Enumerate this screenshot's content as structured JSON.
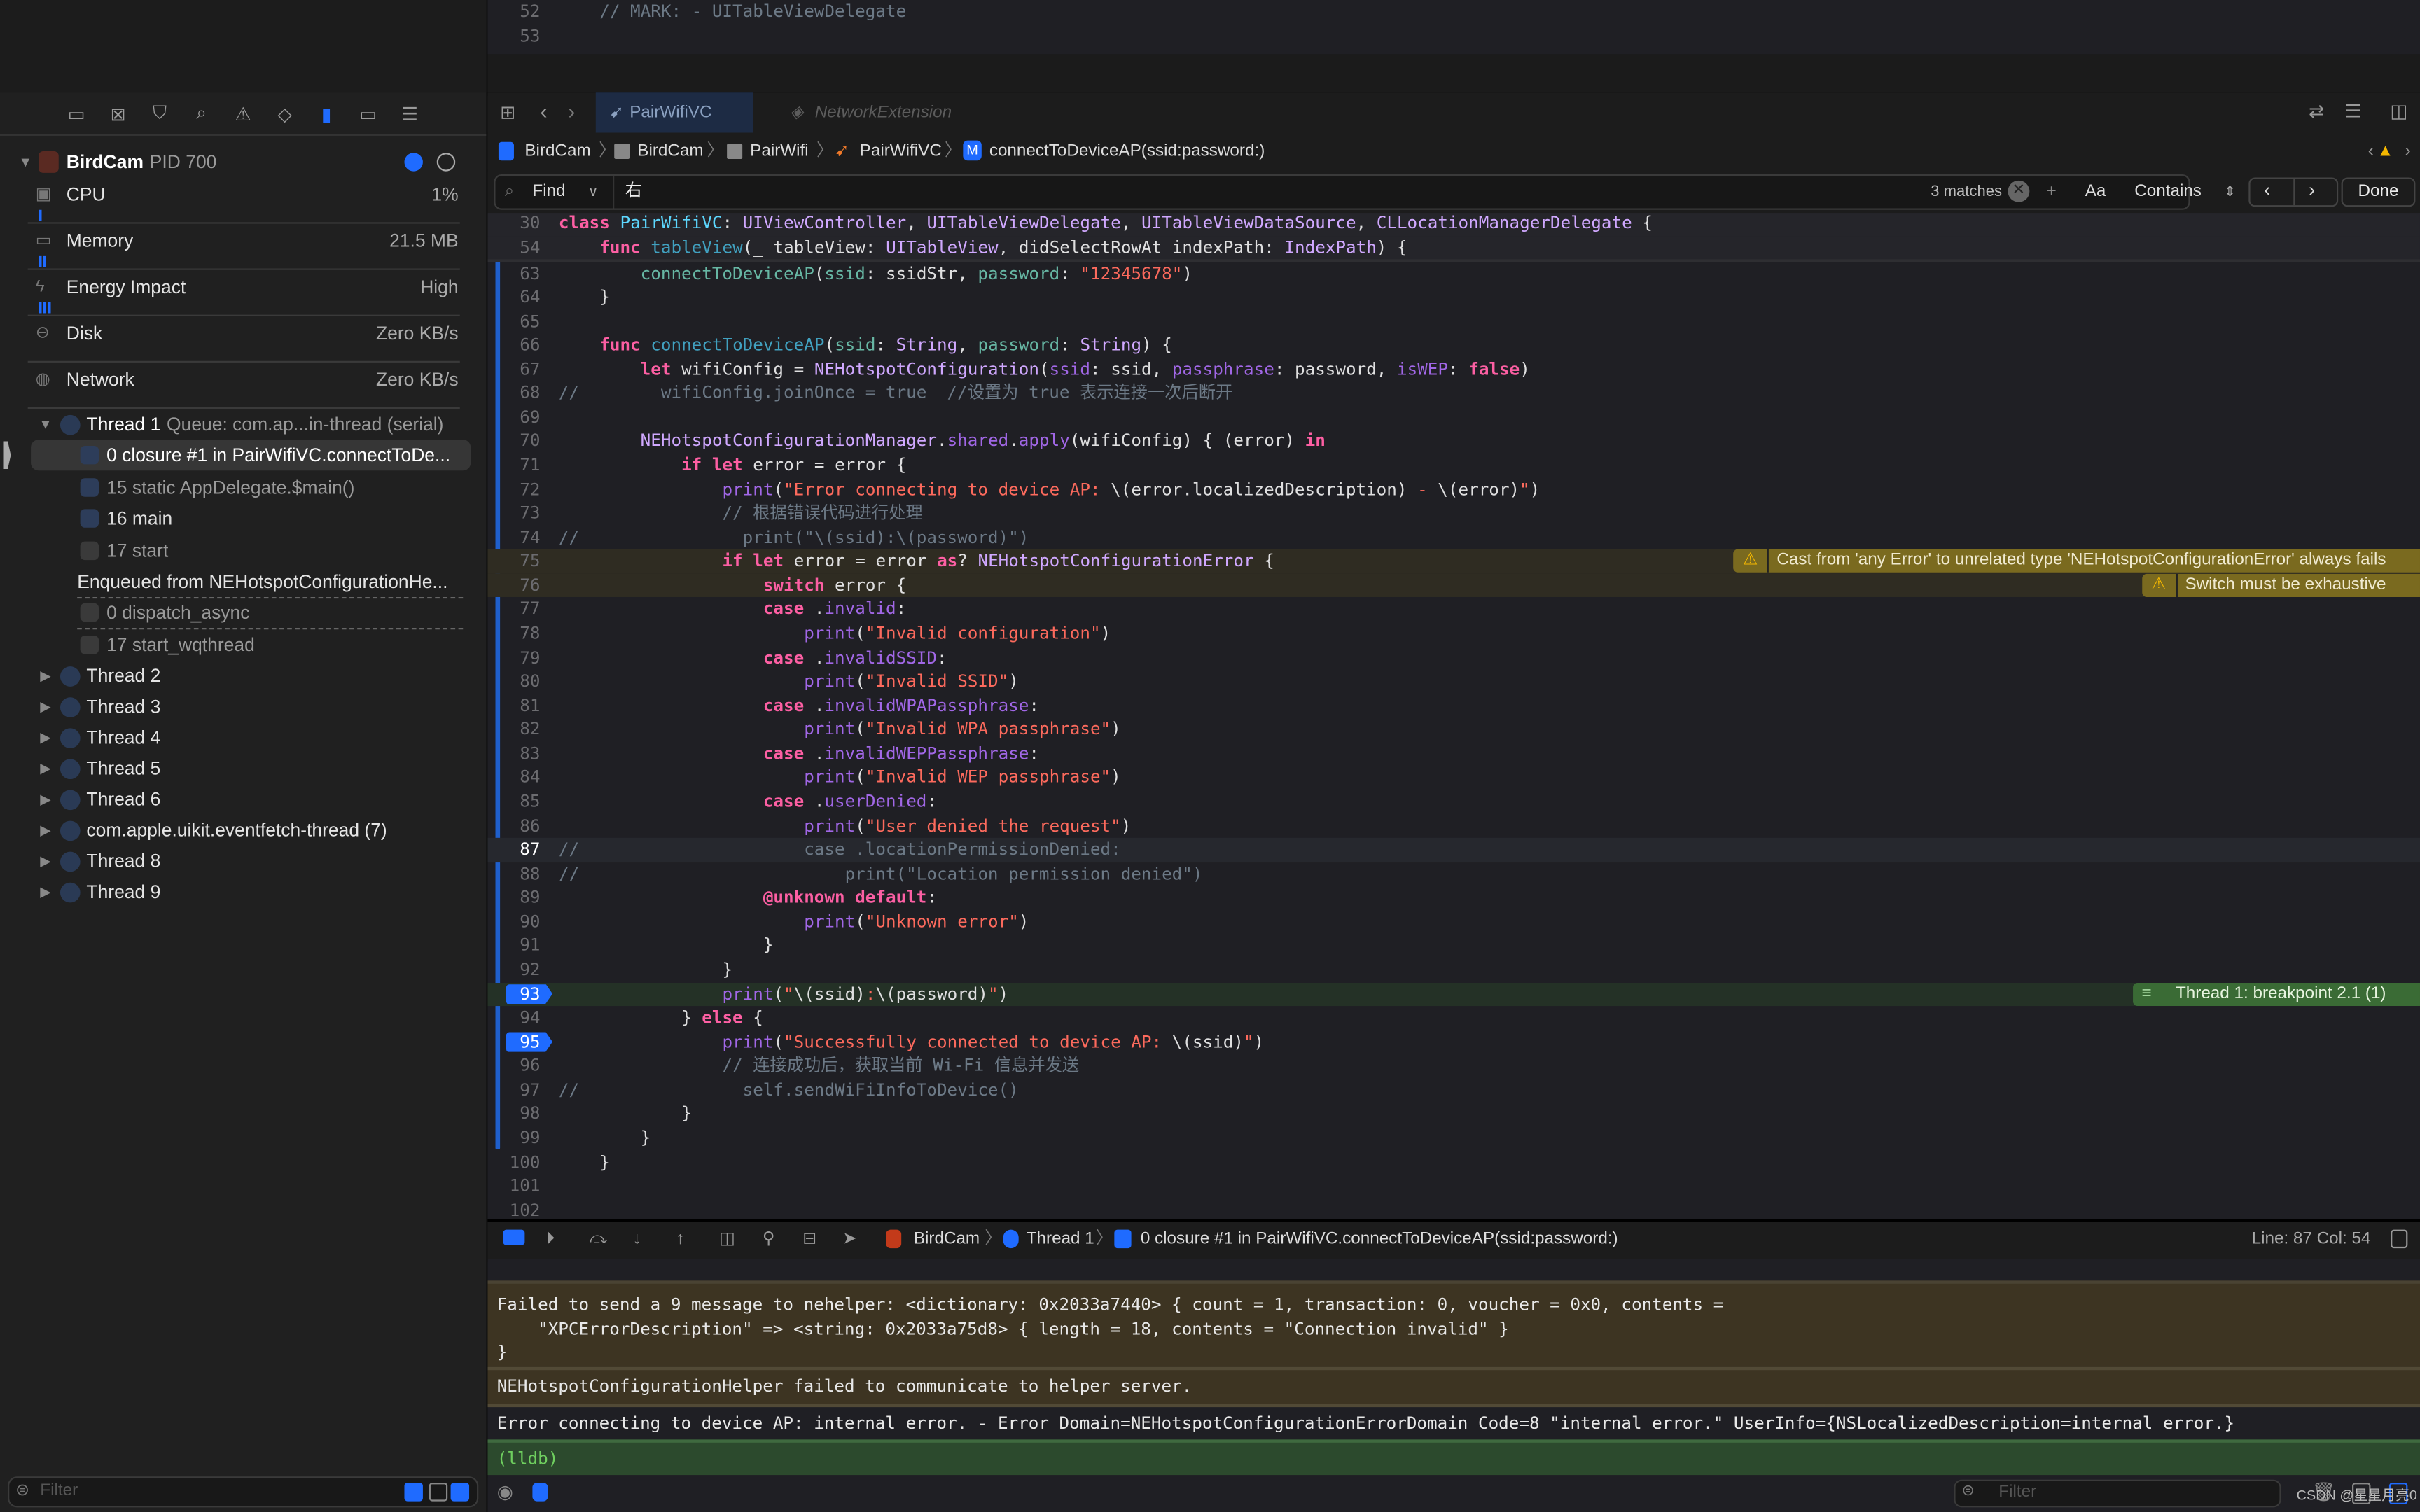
{
  "colors": {
    "accent": "#1f6bff",
    "warning_bg": "#7a6a1f",
    "breakpoint_bg": "#3a6b35",
    "console_error_bg": "#3d3422",
    "lldb_bg": "#2c4a2d",
    "keyword": "#fc5fa3",
    "string": "#fc6a5d",
    "comment": "#6c7986",
    "type": "#d0a8ff"
  },
  "navigator": {
    "toolbar_icons": [
      "folder-icon",
      "source-control-icon",
      "bookmark-icon",
      "find-icon",
      "issue-icon",
      "test-icon",
      "debug-icon",
      "breakpoint-icon",
      "report-icon"
    ],
    "process": {
      "name": "BirdCam",
      "pid": "PID 700"
    },
    "gauges": [
      {
        "label": "CPU",
        "value": "1%",
        "icon": "cpu-icon",
        "level": 0.05
      },
      {
        "label": "Memory",
        "value": "21.5 MB",
        "icon": "memory-icon",
        "level": 0.15
      },
      {
        "label": "Energy Impact",
        "value": "High",
        "icon": "energy-icon",
        "level": 0.2
      },
      {
        "label": "Disk",
        "value": "Zero KB/s",
        "icon": "disk-icon",
        "level": 0
      },
      {
        "label": "Network",
        "value": "Zero KB/s",
        "icon": "network-icon",
        "level": 0
      }
    ],
    "thread1": {
      "name": "Thread 1",
      "queue": "Queue: com.ap...in-thread (serial)"
    },
    "frames": [
      "0 closure #1 in PairWifiVC.connectToDe...",
      "15 static AppDelegate.$main()",
      "16 main",
      "17 start"
    ],
    "enqueued": "Enqueued from NEHotspotConfigurationHe...",
    "enqueued_frames": [
      "0 dispatch_async",
      "17 start_wqthread"
    ],
    "threads": [
      "Thread 2",
      "Thread 3",
      "Thread 4",
      "Thread 5",
      "Thread 6",
      "com.apple.uikit.eventfetch-thread (7)",
      "Thread 8",
      "Thread 9"
    ],
    "filter_placeholder": "Filter"
  },
  "top_split": {
    "lines": [
      {
        "n": "52",
        "code": "    // MARK: - UITableViewDelegate"
      },
      {
        "n": "53",
        "code": ""
      }
    ]
  },
  "tabs": [
    {
      "label": "PairWifiVC",
      "active": true
    },
    {
      "label": "NetworkExtension",
      "active": false
    }
  ],
  "jumpbar": [
    "BirdCam",
    "BirdCam",
    "PairWifi",
    "PairWifiVC",
    "connectToDeviceAP(ssid:password:)"
  ],
  "find": {
    "mode": "Find",
    "query": "右",
    "matches": "3 matches",
    "case_label": "Aa",
    "match_type": "Contains",
    "done": "Done"
  },
  "code": {
    "sticky": [
      {
        "n": "30",
        "code": "class PairWifiVC: UIViewController, UITableViewDelegate, UITableViewDataSource, CLLocationManagerDelegate {"
      },
      {
        "n": "54",
        "code": "    func tableView(_ tableView: UITableView, didSelectRowAt indexPath: IndexPath) {"
      }
    ],
    "lines": [
      {
        "n": "63",
        "code": "        connectToDeviceAP(ssid: ssidStr, password: \"12345678\")"
      },
      {
        "n": "64",
        "code": "    }"
      },
      {
        "n": "65",
        "code": ""
      },
      {
        "n": "66",
        "code": "    func connectToDeviceAP(ssid: String, password: String) {"
      },
      {
        "n": "67",
        "code": "        let wifiConfig = NEHotspotConfiguration(ssid: ssid, passphrase: password, isWEP: false)"
      },
      {
        "n": "68",
        "code": "//        wifiConfig.joinOnce = true  //设置为 true 表示连接一次后断开"
      },
      {
        "n": "69",
        "code": ""
      },
      {
        "n": "70",
        "code": "        NEHotspotConfigurationManager.shared.apply(wifiConfig) { (error) in"
      },
      {
        "n": "71",
        "code": "            if let error = error {"
      },
      {
        "n": "72",
        "code": "                print(\"Error connecting to device AP: \\(error.localizedDescription) - \\(error)\")"
      },
      {
        "n": "73",
        "code": "                // 根据错误代码进行处理"
      },
      {
        "n": "74",
        "code": "//                print(\"\\(ssid):\\(password)\")"
      },
      {
        "n": "75",
        "code": "                if let error = error as? NEHotspotConfigurationError {",
        "warning": "Cast from 'any Error' to unrelated type 'NEHotspotConfigurationError' always fails"
      },
      {
        "n": "76",
        "code": "                    switch error {",
        "warning": "Switch must be exhaustive"
      },
      {
        "n": "77",
        "code": "                    case .invalid:"
      },
      {
        "n": "78",
        "code": "                        print(\"Invalid configuration\")"
      },
      {
        "n": "79",
        "code": "                    case .invalidSSID:"
      },
      {
        "n": "80",
        "code": "                        print(\"Invalid SSID\")"
      },
      {
        "n": "81",
        "code": "                    case .invalidWPAPassphrase:"
      },
      {
        "n": "82",
        "code": "                        print(\"Invalid WPA passphrase\")"
      },
      {
        "n": "83",
        "code": "                    case .invalidWEPPassphrase:"
      },
      {
        "n": "84",
        "code": "                        print(\"Invalid WEP passphrase\")"
      },
      {
        "n": "85",
        "code": "                    case .userDenied:"
      },
      {
        "n": "86",
        "code": "                        print(\"User denied the request\")"
      },
      {
        "n": "87",
        "code": "//                      case .locationPermissionDenied:",
        "current": true
      },
      {
        "n": "88",
        "code": "//                          print(\"Location permission denied\")"
      },
      {
        "n": "89",
        "code": "                    @unknown default:"
      },
      {
        "n": "90",
        "code": "                        print(\"Unknown error\")"
      },
      {
        "n": "91",
        "code": "                    }"
      },
      {
        "n": "92",
        "code": "                }"
      },
      {
        "n": "93",
        "code": "                print(\"\\(ssid):\\(password)\")",
        "breakpoint": true,
        "stopped": "Thread 1: breakpoint 2.1 (1)"
      },
      {
        "n": "94",
        "code": "            } else {"
      },
      {
        "n": "95",
        "code": "                print(\"Successfully connected to device AP: \\(ssid)\")",
        "breakpoint": true
      },
      {
        "n": "96",
        "code": "                // 连接成功后，获取当前 Wi-Fi 信息并发送"
      },
      {
        "n": "97",
        "code": "//                self.sendWiFiInfoToDevice()"
      },
      {
        "n": "98",
        "code": "            }"
      },
      {
        "n": "99",
        "code": "        }"
      },
      {
        "n": "100",
        "code": "    }"
      },
      {
        "n": "101",
        "code": ""
      },
      {
        "n": "102",
        "code": ""
      }
    ]
  },
  "debugbar": {
    "process": "BirdCam",
    "thread": "Thread 1",
    "frame": "0 closure #1 in PairWifiVC.connectToDeviceAP(ssid:password:)",
    "position": "Line: 87  Col: 54"
  },
  "console": {
    "block1": "Failed to send a 9 message to nehelper: <dictionary: 0x2033a7440> { count = 1, transaction: 0, voucher = 0x0, contents =\n    \"XPCErrorDescription\" => <string: 0x2033a75d8> { length = 18, contents = \"Connection invalid\" }\n}",
    "block2": "NEHotspotConfigurationHelper failed to communicate to helper server.",
    "block3": "Error connecting to device AP: internal error. - Error Domain=NEHotspotConfigurationErrorDomain Code=8 \"internal error.\" UserInfo={NSLocalizedDescription=internal error.}",
    "prompt": "(lldb)",
    "filter_placeholder": "Filter"
  },
  "watermark": "CSDN @星星月亮0"
}
